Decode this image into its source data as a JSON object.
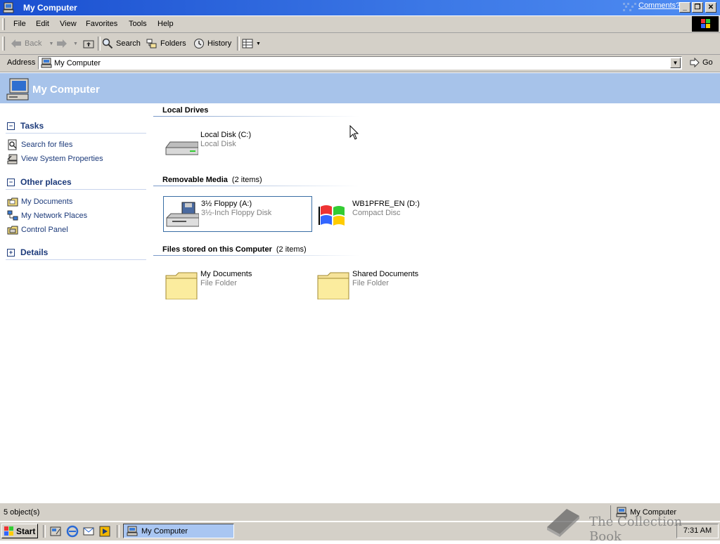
{
  "window": {
    "title": "My Computer",
    "comments_link": "Comments?",
    "buttons": [
      "_",
      "❐",
      "✕"
    ]
  },
  "menubar": {
    "items": [
      "File",
      "Edit",
      "View",
      "Favorites",
      "Tools",
      "Help"
    ]
  },
  "toolbar": {
    "back": "Back",
    "search": "Search",
    "folders": "Folders",
    "history": "History"
  },
  "address": {
    "label": "Address",
    "value": "My Computer",
    "go": "Go"
  },
  "header": {
    "title": "My Computer"
  },
  "left_pane": {
    "tasks": {
      "title": "Tasks",
      "toggle": "−",
      "items": [
        "Search for files",
        "View System Properties"
      ]
    },
    "other_places": {
      "title": "Other places",
      "toggle": "−",
      "items": [
        "My Documents",
        "My Network Places",
        "Control Panel"
      ]
    },
    "details": {
      "title": "Details",
      "toggle": "+"
    }
  },
  "groups": [
    {
      "title": "Local Drives",
      "count": "",
      "items": [
        {
          "name": "Local Disk (C:)",
          "type": "Local Disk",
          "icon": "hard-drive-icon"
        }
      ]
    },
    {
      "title": "Removable Media",
      "count": "(2 items)",
      "items": [
        {
          "name": "3½ Floppy (A:)",
          "type": "3½-Inch Floppy Disk",
          "icon": "floppy-drive-icon",
          "selected": true
        },
        {
          "name": "WB1PFRE_EN (D:)",
          "type": "Compact Disc",
          "icon": "windows-cd-icon"
        }
      ]
    },
    {
      "title": "Files stored on this Computer",
      "count": "(2 items)",
      "items": [
        {
          "name": "My Documents",
          "type": "File Folder",
          "icon": "folder-icon"
        },
        {
          "name": "Shared Documents",
          "type": "File Folder",
          "icon": "folder-icon"
        }
      ]
    }
  ],
  "statusbar": {
    "left": "5 object(s)",
    "right": "My Computer"
  },
  "taskbar": {
    "start": "Start",
    "task": "My Computer",
    "clock": "7:31 AM"
  },
  "watermark": {
    "text": "The Collection Book"
  },
  "colors": {
    "title_bar": "#1a4fd0",
    "header_band": "#a7c3ea",
    "task_link": "#1c3a7a",
    "chrome": "#d4d0c8"
  }
}
